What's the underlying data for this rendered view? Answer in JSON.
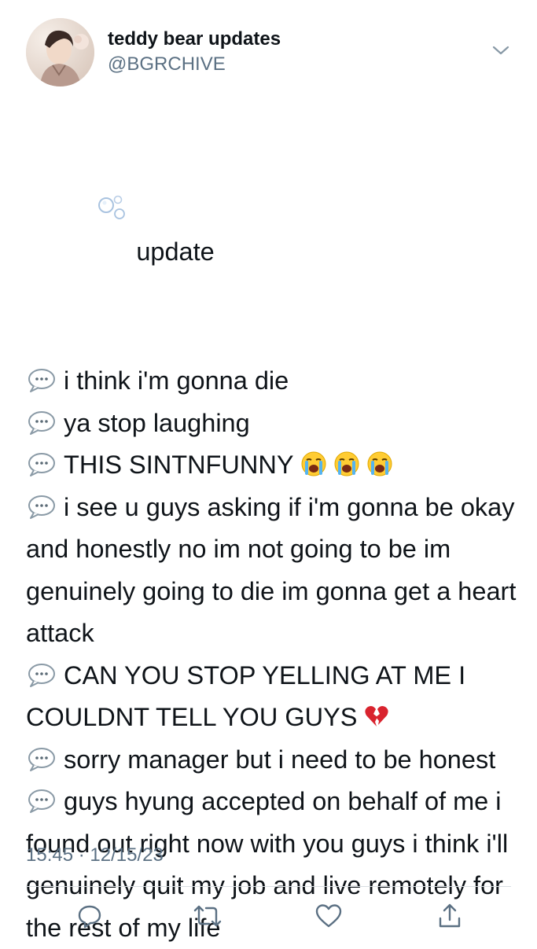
{
  "header": {
    "display_name": "teddy bear updates",
    "handle": "@BGRCHIVE"
  },
  "tweet": {
    "heading": "update",
    "entries": [
      {
        "text": "i think i'm gonna die",
        "emoji": []
      },
      {
        "text": "ya stop laughing",
        "emoji": []
      },
      {
        "text": "THIS SINTNFUNNY",
        "emoji": [
          "loudly-crying-face",
          "loudly-crying-face",
          "loudly-crying-face"
        ]
      },
      {
        "text": "i see u guys asking if i'm gonna be okay and honestly no im not going to be im genuinely going to die im gonna get a heart attack",
        "emoji": []
      },
      {
        "text": "CAN YOU STOP YELLING AT ME I COULDNT TELL YOU GUYS",
        "emoji": [
          "broken-heart"
        ]
      },
      {
        "text": "sorry manager but i need to be honest",
        "emoji": []
      },
      {
        "text": "guys hyung accepted on behalf of me i found out right now with you guys i think i'll genuinely quit my job and live remotely for the rest of my life",
        "emoji": []
      }
    ],
    "timestamp": "15:45 · 12/15/23"
  },
  "icons": {
    "heading_icon": "bubbles-icon",
    "entry_icon": "speech-balloon-icon",
    "menu_icon": "chevron-down-icon",
    "actions": [
      "reply-icon",
      "retweet-icon",
      "like-icon",
      "share-icon"
    ]
  },
  "colors": {
    "text": "#0f1419",
    "secondary": "#5b7083",
    "divider": "#d9dee2",
    "action_icon": "#5b7083"
  }
}
